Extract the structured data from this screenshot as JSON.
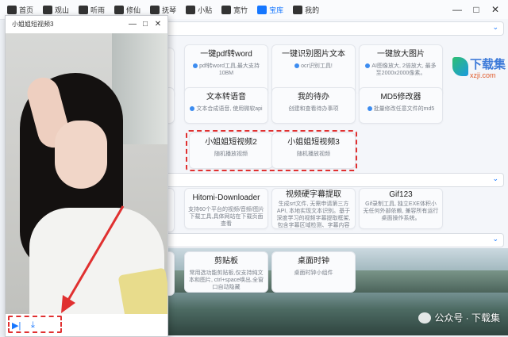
{
  "tabs": [
    {
      "label": "首页",
      "icon": "home-icon"
    },
    {
      "label": "观山",
      "icon": "mountain-icon"
    },
    {
      "label": "听雨",
      "icon": "music-icon"
    },
    {
      "label": "修仙",
      "icon": "book-icon"
    },
    {
      "label": "抚琴",
      "icon": "folder-icon"
    },
    {
      "label": "小贴",
      "icon": "list-icon"
    },
    {
      "label": "宽竹",
      "icon": "image-icon"
    },
    {
      "label": "宝库",
      "icon": "treasure-icon",
      "active": true
    },
    {
      "label": "我的",
      "icon": "user-icon"
    }
  ],
  "window_controls": {
    "minimize": "—",
    "maximize": "□",
    "close": "✕"
  },
  "popup": {
    "title": "小姐姐短视频3",
    "controls": {
      "minimize": "—",
      "maximize": "□",
      "close": "✕"
    },
    "play_icon": "▶|",
    "download_icon": "⤓"
  },
  "cards_row1": [
    {
      "title": "一键pdf转word",
      "desc": "pdf转word工具,最大支持10BM"
    },
    {
      "title": "一键识别图片文本",
      "desc": "ocr识别工具!"
    },
    {
      "title": "一键放大图片",
      "desc": "AI图像放大, 2倍放大, 最多至2000x2000像素。"
    }
  ],
  "cards_row2": [
    {
      "title": "文本转语音",
      "desc": "文本合成语音, 使用微软api"
    },
    {
      "title": "我的待办",
      "desc": "创建和查看待办事项"
    },
    {
      "title": "MD5修改器",
      "desc": "批量修改任意文件的md5"
    }
  ],
  "cards_row3": [
    {
      "title": "小姐姐短视频2",
      "desc": "随机播放视频"
    },
    {
      "title": "小姐姐短视频3",
      "desc": "随机播放视频"
    }
  ],
  "cards_row4": [
    {
      "title": "Hitomi-Downloader",
      "desc": "支持60个平台的视频/音频/图片下载工具,具体网站在下载页面查看"
    },
    {
      "title": "视频硬字幕提取",
      "desc": "生成srt文件, 无需申请第三方API, 本地实现文本识别。基于深度学习的视频字幕提取框架, 包含字幕区域检测、字幕内容提取。"
    },
    {
      "title": "Gif123",
      "desc": "Gif录制工具, 独立EXE体积小无任何外部依赖, 兼容所有运行桌面操作系统。"
    }
  ],
  "cards_row5": [
    {
      "title": "剪贴板",
      "desc": "常用选功能剪贴板,仅支持纯文本和图片, ctrl+space唤出,全窗口自动隐藏"
    },
    {
      "title": "桌面时钟",
      "desc": "桌面时钟小组件"
    }
  ],
  "watermark": {
    "logo": "下载集",
    "site": "xzji.com"
  },
  "wechat_watermark": "公众号 · 下载集"
}
